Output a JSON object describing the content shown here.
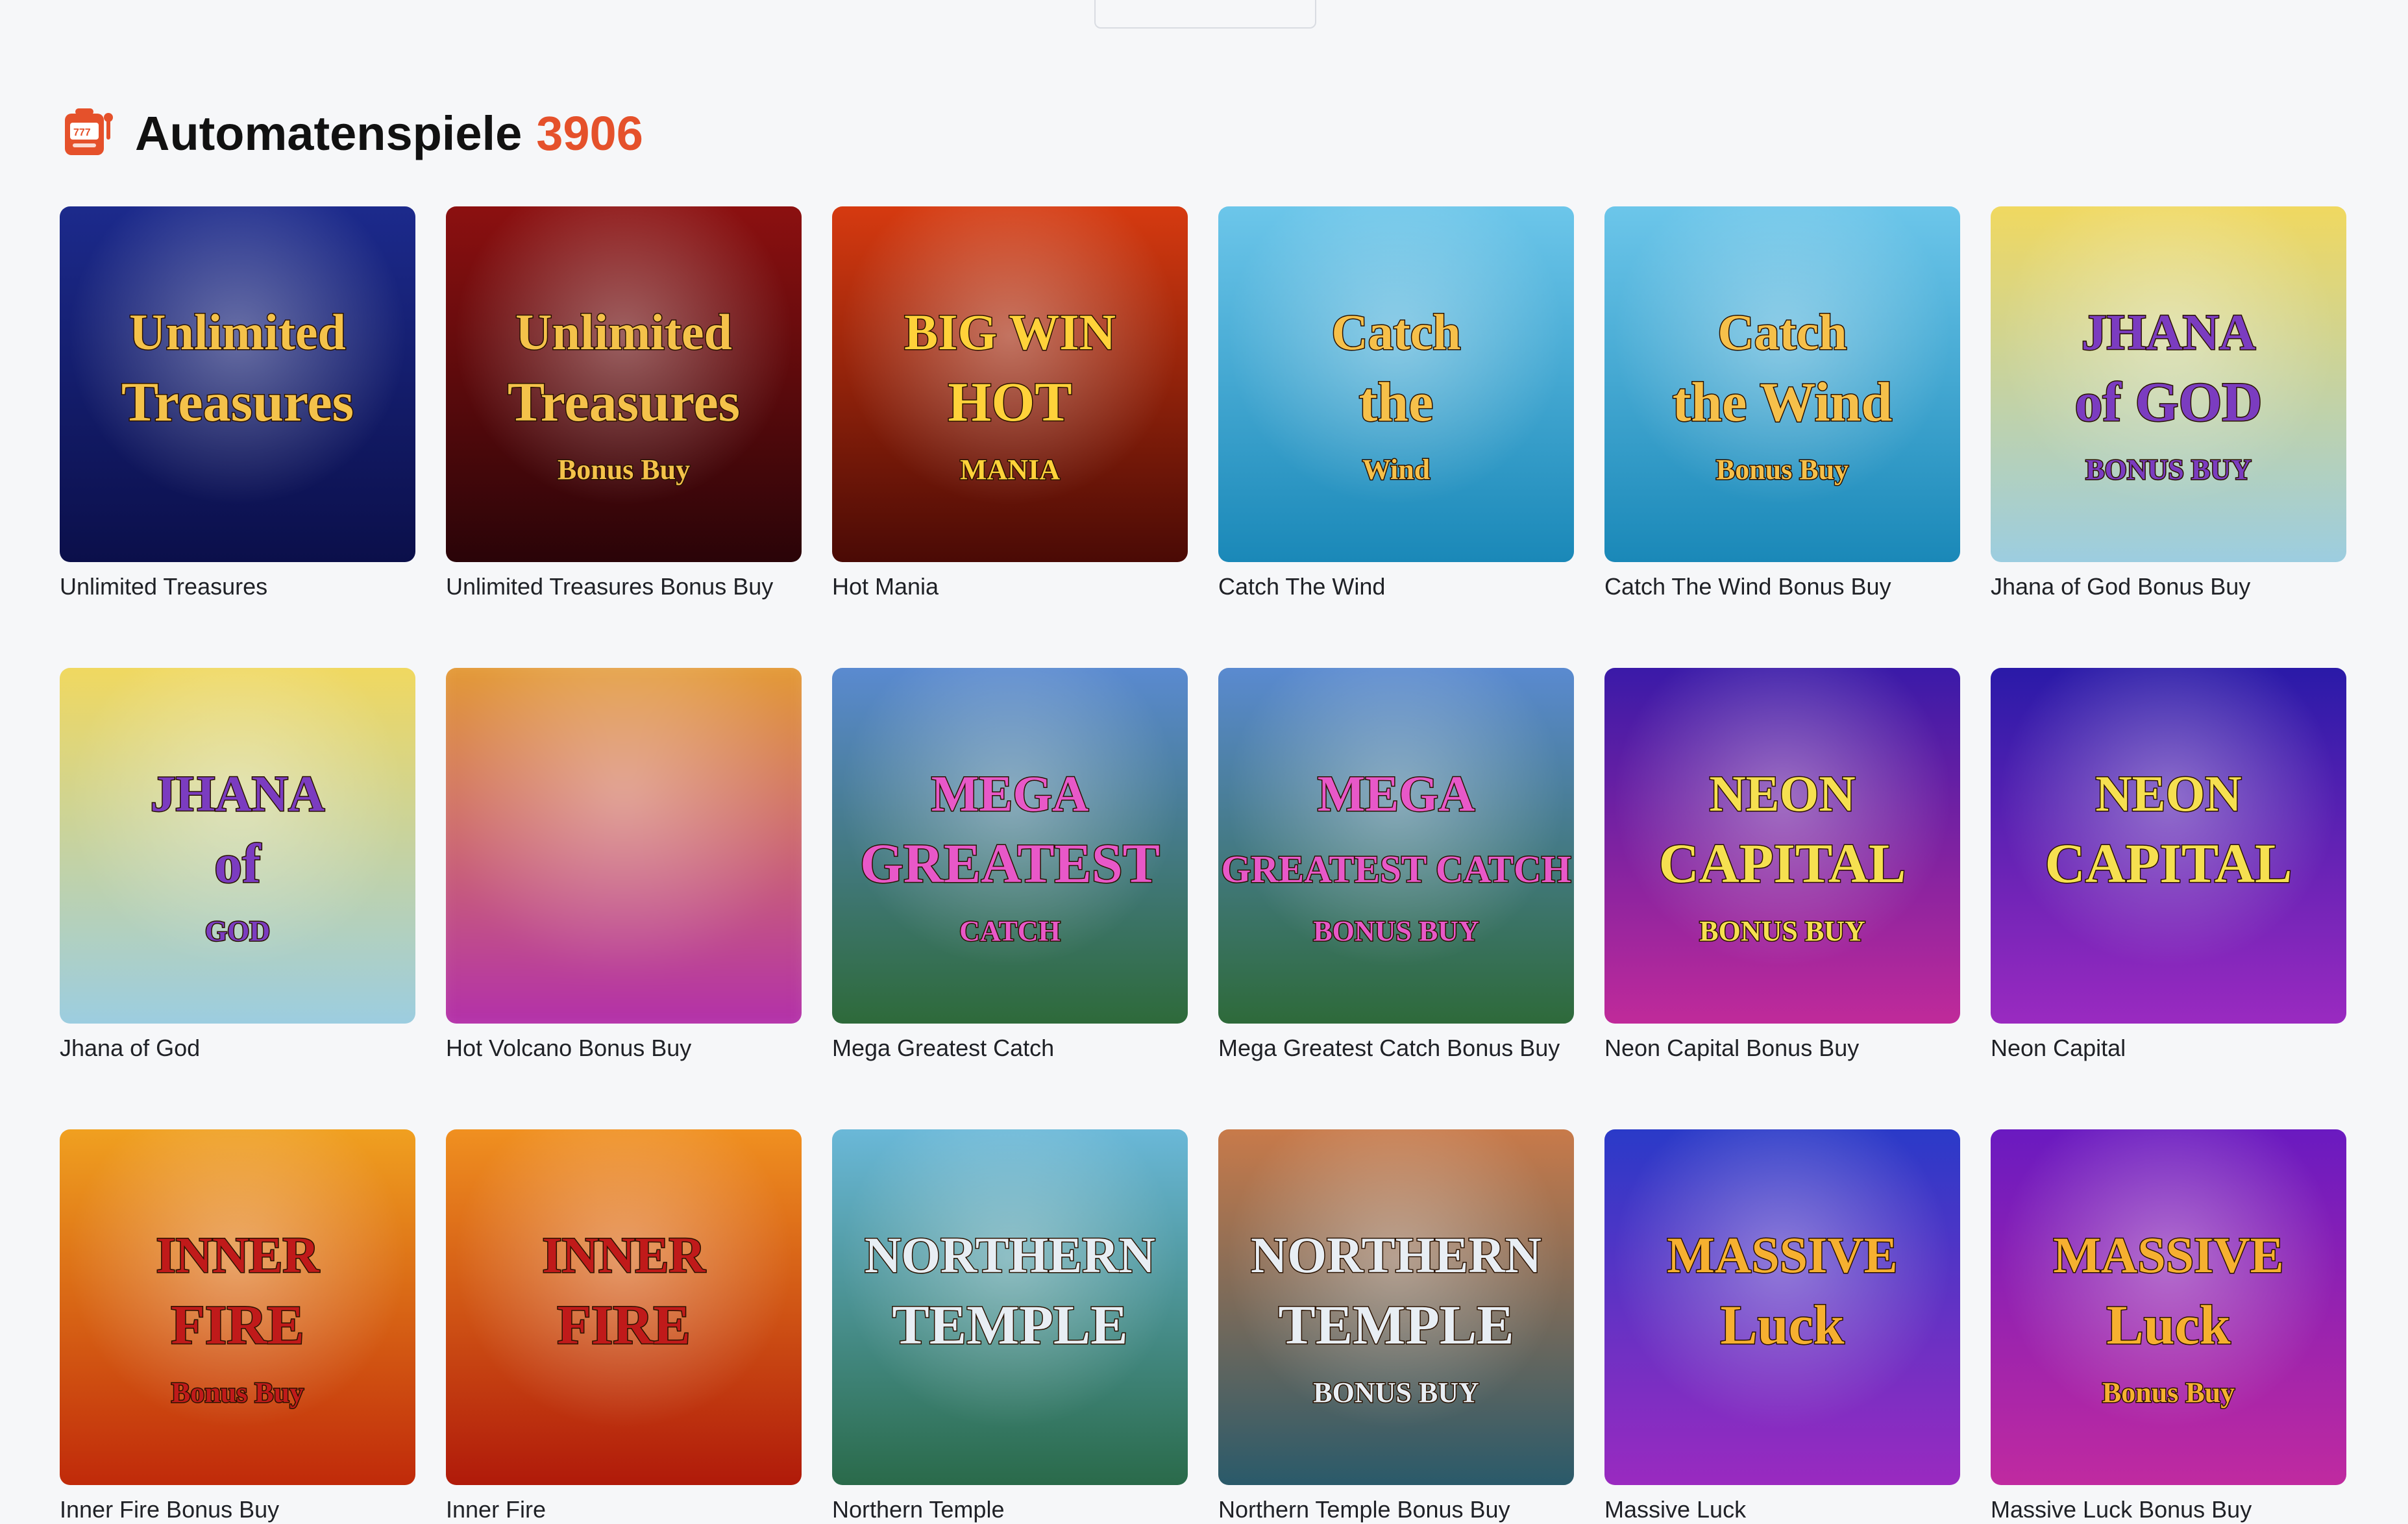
{
  "section": {
    "title": "Automatenspiele",
    "count": "3906",
    "icon": "slot-machine-icon",
    "accent": "#e5512b"
  },
  "games": [
    {
      "name": "Unlimited Treasures",
      "art": [
        "Unlimited",
        "Treasures",
        ""
      ],
      "bg": [
        "#1c2a8c",
        "#0b0f4a"
      ],
      "text": "#f4c24a",
      "blurred": false
    },
    {
      "name": "Unlimited Treasures Bonus Buy",
      "art": [
        "Unlimited",
        "Treasures",
        "Bonus Buy"
      ],
      "bg": [
        "#8c1010",
        "#2a0408"
      ],
      "text": "#f4c24a",
      "blurred": false
    },
    {
      "name": "Hot Mania",
      "art": [
        "BIG WIN",
        "HOT",
        "MANIA"
      ],
      "bg": [
        "#d63a10",
        "#4a0a05"
      ],
      "text": "#ffd23a",
      "blurred": false
    },
    {
      "name": "Catch The Wind",
      "art": [
        "Catch",
        "the",
        "Wind"
      ],
      "bg": [
        "#6cc6ea",
        "#1a88b8"
      ],
      "text": "#f6c04a",
      "blurred": false
    },
    {
      "name": "Catch The Wind Bonus Buy",
      "art": [
        "Catch",
        "the Wind",
        "Bonus Buy"
      ],
      "bg": [
        "#6cc6ea",
        "#1a88b8"
      ],
      "text": "#f6c04a",
      "blurred": false
    },
    {
      "name": "Jhana of God Bonus Buy",
      "art": [
        "JHANA",
        "of GOD",
        "BONUS BUY"
      ],
      "bg": [
        "#f0d860",
        "#9ccde0"
      ],
      "text": "#7b3cc0",
      "blurred": false
    },
    {
      "name": "Jhana of God",
      "art": [
        "JHANA",
        "of",
        "GOD"
      ],
      "bg": [
        "#f0d860",
        "#9ccde0"
      ],
      "text": "#7b3cc0",
      "blurred": false
    },
    {
      "name": "Hot Volcano Bonus Buy",
      "art": [
        "",
        "",
        ""
      ],
      "bg": [
        "#e6a030",
        "#b02ab0"
      ],
      "text": "#3a2aa0",
      "blurred": true
    },
    {
      "name": "Mega Greatest Catch",
      "art": [
        "MEGA",
        "GREATEST",
        "CATCH"
      ],
      "bg": [
        "#5a8ad0",
        "#2e6a3a"
      ],
      "text": "#e858c8",
      "blurred": false
    },
    {
      "name": "Mega Greatest Catch Bonus Buy",
      "art": [
        "MEGA",
        "GREATEST CATCH",
        "BONUS BUY"
      ],
      "bg": [
        "#5a8ad0",
        "#2e6a3a"
      ],
      "text": "#e858c8",
      "blurred": false
    },
    {
      "name": "Neon Capital Bonus Buy",
      "art": [
        "NEON",
        "CAPITAL",
        "BONUS BUY"
      ],
      "bg": [
        "#3a1aa8",
        "#c02a9a"
      ],
      "text": "#f6e050",
      "blurred": false
    },
    {
      "name": "Neon Capital",
      "art": [
        "NEON",
        "CAPITAL",
        ""
      ],
      "bg": [
        "#2a1aa8",
        "#9a2ac0"
      ],
      "text": "#f6e050",
      "blurred": false
    },
    {
      "name": "Inner Fire Bonus Buy",
      "art": [
        "INNER",
        "FIRE",
        "Bonus Buy"
      ],
      "bg": [
        "#f0a020",
        "#c02a0a"
      ],
      "text": "#c01a1a",
      "blurred": false
    },
    {
      "name": "Inner Fire",
      "art": [
        "INNER",
        "FIRE",
        ""
      ],
      "bg": [
        "#f09020",
        "#b01a0a"
      ],
      "text": "#c01a1a",
      "blurred": false
    },
    {
      "name": "Northern Temple",
      "art": [
        "NORTHERN",
        "TEMPLE",
        ""
      ],
      "bg": [
        "#6ab8d8",
        "#2a6a4a"
      ],
      "text": "#e8eef4",
      "blurred": false
    },
    {
      "name": "Northern Temple Bonus Buy",
      "art": [
        "NORTHERN",
        "TEMPLE",
        "BONUS BUY"
      ],
      "bg": [
        "#c87a4a",
        "#2a5a6a"
      ],
      "text": "#e8eef4",
      "blurred": false
    },
    {
      "name": "Massive Luck",
      "art": [
        "MASSIVE",
        "Luck",
        ""
      ],
      "bg": [
        "#2a3ac8",
        "#9a2ac0"
      ],
      "text": "#f6b030",
      "blurred": false
    },
    {
      "name": "Massive Luck Bonus Buy",
      "art": [
        "MASSIVE",
        "Luck",
        "Bonus Buy"
      ],
      "bg": [
        "#6a1ac0",
        "#c02aa0"
      ],
      "text": "#f6b030",
      "blurred": false
    }
  ]
}
